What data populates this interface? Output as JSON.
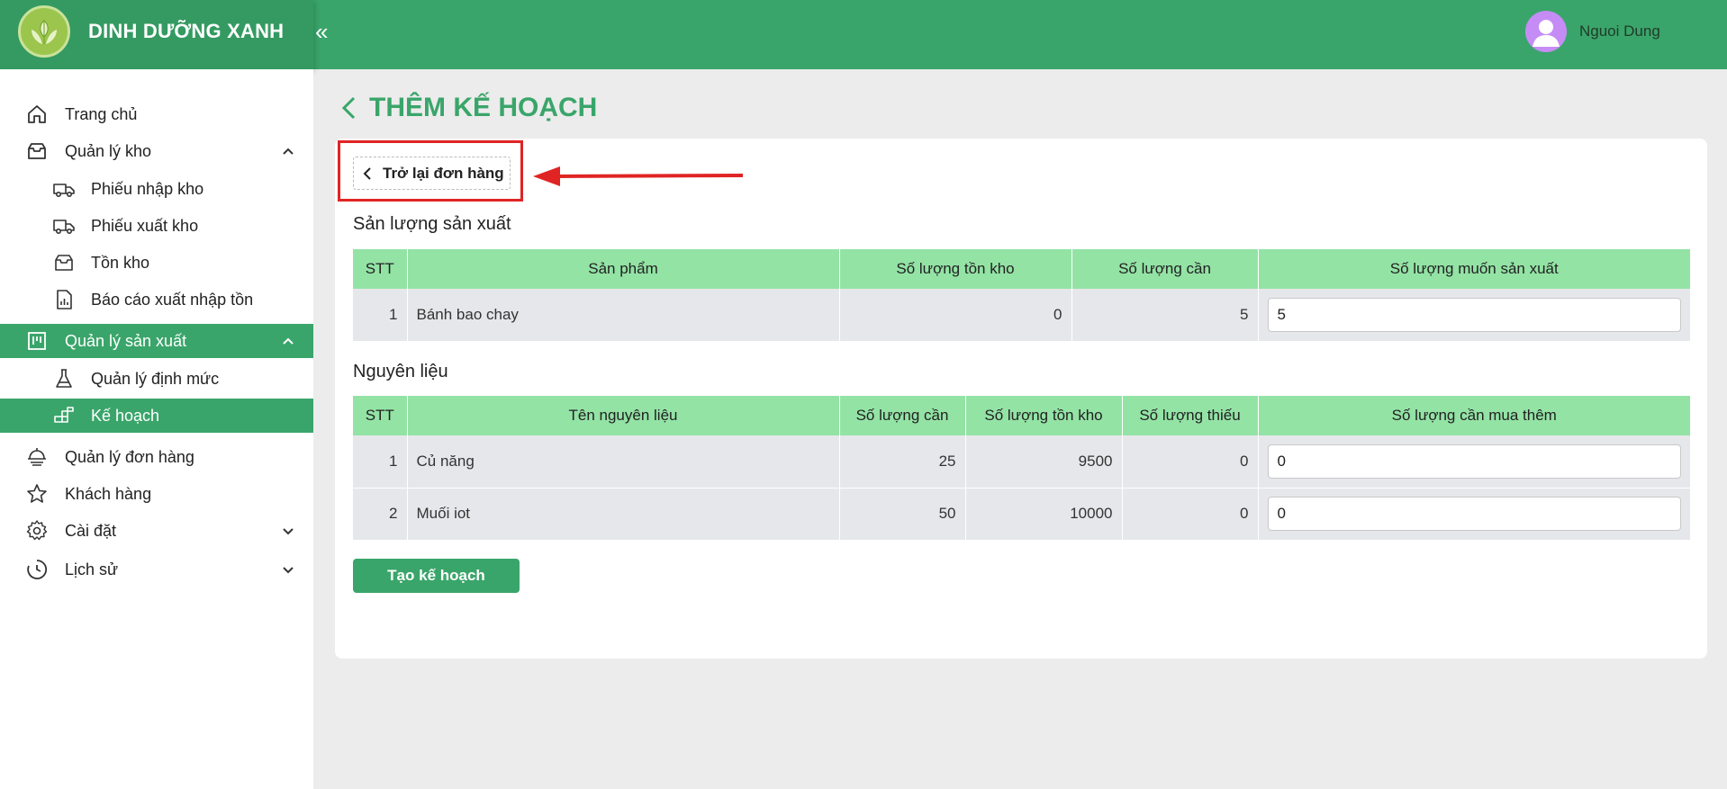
{
  "app": {
    "brand": "DINH DƯỠNG XANH"
  },
  "header": {
    "user_name": "Nguoi Dung"
  },
  "sidebar": {
    "items": [
      {
        "label": "Trang chủ"
      },
      {
        "label": "Quản lý kho"
      },
      {
        "label": "Phiếu nhập kho"
      },
      {
        "label": "Phiếu xuất kho"
      },
      {
        "label": "Tồn kho"
      },
      {
        "label": "Báo cáo xuất nhập tồn"
      },
      {
        "label": "Quản lý sản xuất"
      },
      {
        "label": "Quản lý định mức"
      },
      {
        "label": "Kế hoạch"
      },
      {
        "label": "Quản lý đơn hàng"
      },
      {
        "label": "Khách hàng"
      },
      {
        "label": "Cài đặt"
      },
      {
        "label": "Lịch sử"
      }
    ]
  },
  "page": {
    "title": "THÊM KẾ HOẠCH",
    "back_button": "Trở lại đơn hàng",
    "production": {
      "title": "Sản lượng sản xuất",
      "headers": [
        "STT",
        "Sản phẩm",
        "Số lượng tồn kho",
        "Số lượng cần",
        "Số lượng muốn sản xuất"
      ],
      "rows": [
        {
          "stt": "1",
          "product": "Bánh bao chay",
          "stock": "0",
          "needed": "5",
          "produce": "5"
        }
      ]
    },
    "materials": {
      "title": "Nguyên liệu",
      "headers": [
        "STT",
        "Tên nguyên liệu",
        "Số lượng cần",
        "Số lượng tồn kho",
        "Số lượng thiếu",
        "Số lượng cần mua thêm"
      ],
      "rows": [
        {
          "stt": "1",
          "name": "Củ năng",
          "needed": "25",
          "stock": "9500",
          "shortage": "0",
          "buy": "0"
        },
        {
          "stt": "2",
          "name": "Muối iot",
          "needed": "50",
          "stock": "10000",
          "shortage": "0",
          "buy": "0"
        }
      ]
    },
    "create_button": "Tạo kế hoạch"
  }
}
